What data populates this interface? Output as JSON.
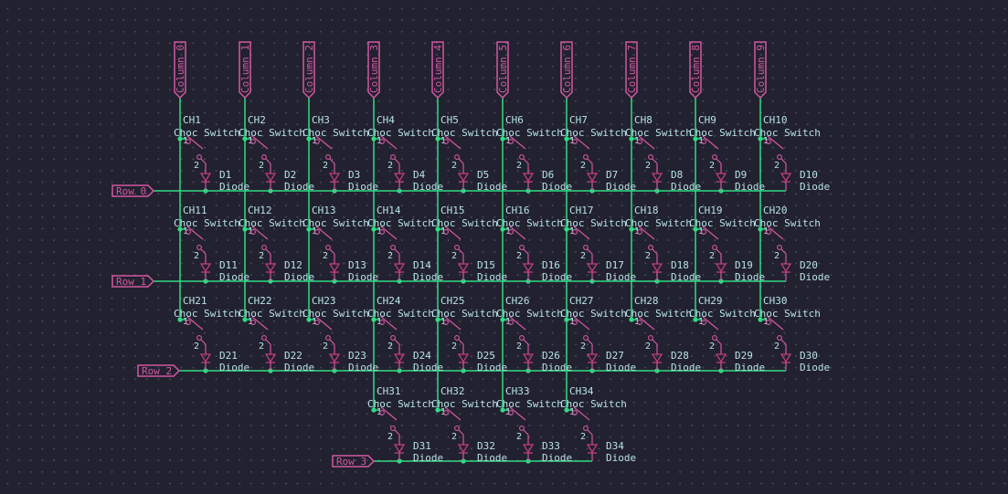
{
  "columns": [
    {
      "label": "Column 0"
    },
    {
      "label": "Column 1"
    },
    {
      "label": "Column 2"
    },
    {
      "label": "Column 3"
    },
    {
      "label": "Column 4"
    },
    {
      "label": "Column 5"
    },
    {
      "label": "Column 6"
    },
    {
      "label": "Column 7"
    },
    {
      "label": "Column 8"
    },
    {
      "label": "Column 9"
    }
  ],
  "rows": [
    {
      "label": "Row 0"
    },
    {
      "label": "Row 1"
    },
    {
      "label": "Row 2"
    },
    {
      "label": "Row 3"
    }
  ],
  "switch_value": "Choc Switch",
  "diode_value": "Diode",
  "pin_labels": {
    "pin1": "1",
    "pin2": "2"
  },
  "switches": [
    {
      "ref": "CH1",
      "diode": "D1"
    },
    {
      "ref": "CH2",
      "diode": "D2"
    },
    {
      "ref": "CH3",
      "diode": "D3"
    },
    {
      "ref": "CH4",
      "diode": "D4"
    },
    {
      "ref": "CH5",
      "diode": "D5"
    },
    {
      "ref": "CH6",
      "diode": "D6"
    },
    {
      "ref": "CH7",
      "diode": "D7"
    },
    {
      "ref": "CH8",
      "diode": "D8"
    },
    {
      "ref": "CH9",
      "diode": "D9"
    },
    {
      "ref": "CH10",
      "diode": "D10"
    },
    {
      "ref": "CH11",
      "diode": "D11"
    },
    {
      "ref": "CH12",
      "diode": "D12"
    },
    {
      "ref": "CH13",
      "diode": "D13"
    },
    {
      "ref": "CH14",
      "diode": "D14"
    },
    {
      "ref": "CH15",
      "diode": "D15"
    },
    {
      "ref": "CH16",
      "diode": "D16"
    },
    {
      "ref": "CH17",
      "diode": "D17"
    },
    {
      "ref": "CH18",
      "diode": "D18"
    },
    {
      "ref": "CH19",
      "diode": "D19"
    },
    {
      "ref": "CH20",
      "diode": "D20"
    },
    {
      "ref": "CH21",
      "diode": "D21"
    },
    {
      "ref": "CH22",
      "diode": "D22"
    },
    {
      "ref": "CH23",
      "diode": "D23"
    },
    {
      "ref": "CH24",
      "diode": "D24"
    },
    {
      "ref": "CH25",
      "diode": "D25"
    },
    {
      "ref": "CH26",
      "diode": "D26"
    },
    {
      "ref": "CH27",
      "diode": "D27"
    },
    {
      "ref": "CH28",
      "diode": "D28"
    },
    {
      "ref": "CH29",
      "diode": "D29"
    },
    {
      "ref": "CH30",
      "diode": "D30"
    },
    {
      "ref": "CH31",
      "diode": "D31"
    },
    {
      "ref": "CH32",
      "diode": "D32"
    },
    {
      "ref": "CH33",
      "diode": "D33"
    },
    {
      "ref": "CH34",
      "diode": "D34"
    }
  ],
  "colors": {
    "background": "#22212f",
    "wire": "#2fdc82",
    "port": "#d259a2",
    "symbol": "#d259a2",
    "text": "#b7e3e6"
  }
}
